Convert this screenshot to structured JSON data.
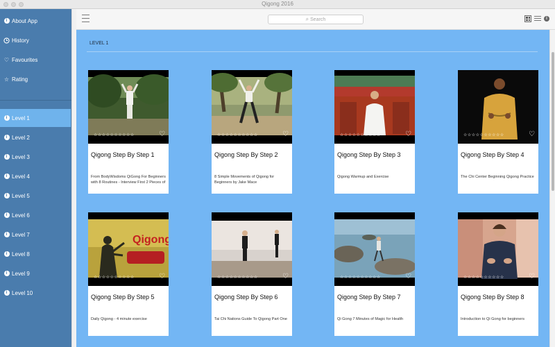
{
  "window": {
    "title": "Qigong 2016"
  },
  "sidebar": {
    "top_items": [
      {
        "label": "About App",
        "icon": "info-circle-icon"
      },
      {
        "label": "History",
        "icon": "clock-icon"
      },
      {
        "label": "Favourites",
        "icon": "heart-icon"
      },
      {
        "label": "Rating",
        "icon": "star-icon"
      }
    ],
    "levels": [
      {
        "label": "Level 1",
        "active": true
      },
      {
        "label": "Level 2"
      },
      {
        "label": "Level 3"
      },
      {
        "label": "Level 4"
      },
      {
        "label": "Level 5"
      },
      {
        "label": "Level 6"
      },
      {
        "label": "Level 7"
      },
      {
        "label": "Level 8"
      },
      {
        "label": "Level 9"
      },
      {
        "label": "Level 10"
      }
    ]
  },
  "toolbar": {
    "search_placeholder": "Search",
    "menu_icon": "hamburger-icon",
    "view_icons": [
      "grid-view-icon",
      "list-view-icon",
      "info-icon"
    ]
  },
  "content": {
    "section_heading": "LEVEL 1",
    "videos": [
      {
        "title": "Qigong Step By Step 1",
        "description": "From BodyWisdoms QiGong For Beginners with 8 Routines - Interview  First 2 Pieces of",
        "rating_stars": "☆☆☆☆☆☆☆☆☆☆"
      },
      {
        "title": "Qigong Step By Step 2",
        "description": "8 Simple Movements of Qigong for Beginners by Jake Mace",
        "rating_stars": "☆☆☆☆☆☆☆☆☆☆"
      },
      {
        "title": "Qigong Step By Step 3",
        "description": "Qigong Warmup and Exercise",
        "rating_stars": "☆☆☆☆☆☆☆☆☆☆"
      },
      {
        "title": "Qigong Step By Step 4",
        "description": "The Chi Center  Beginning Qigong Practice",
        "rating_stars": "☆☆☆☆☆☆☆☆☆☆"
      },
      {
        "title": "Qigong Step By Step 5",
        "description": "Daily Qigong - 4 minute exercise",
        "rating_stars": "☆☆☆☆☆☆☆☆☆☆",
        "overlay_text": "Qigong for Beginners"
      },
      {
        "title": "Qigong Step By Step 6",
        "description": "Tai Chi Nations Guide To Qigong Part One",
        "rating_stars": "☆☆☆☆☆☆☆☆☆☆"
      },
      {
        "title": "Qigong Step By Step 7",
        "description": "Qi Gong 7 Minutes of Magic for Health",
        "rating_stars": "☆☆☆☆☆☆☆☆☆☆"
      },
      {
        "title": "Qigong Step By Step 8",
        "description": "Introduction to Qi Gong for beginners",
        "rating_stars": "☆☆☆☆☆☆☆☆☆☆"
      }
    ]
  },
  "colors": {
    "sidebar_bg": "#4a7cad",
    "sidebar_active": "#6fb3ec",
    "content_bg": "#73b6f4"
  }
}
